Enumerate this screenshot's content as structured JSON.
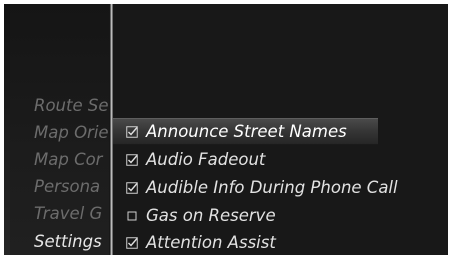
{
  "sidebar": {
    "items": [
      {
        "label": "Route Se",
        "active": false
      },
      {
        "label": "Map Orie",
        "active": false
      },
      {
        "label": "Map Cor",
        "active": false
      },
      {
        "label": "Persona",
        "active": false
      },
      {
        "label": "Travel G",
        "active": false
      },
      {
        "label": "Settings",
        "active": true
      }
    ]
  },
  "settings": {
    "options": [
      {
        "label": "Announce Street Names",
        "checked": true,
        "selected": true
      },
      {
        "label": "Audio Fadeout",
        "checked": true,
        "selected": false
      },
      {
        "label": "Audible Info During Phone Call",
        "checked": true,
        "selected": false
      },
      {
        "label": "Gas on Reserve",
        "checked": false,
        "selected": false
      },
      {
        "label": "Attention Assist",
        "checked": true,
        "selected": false
      }
    ]
  },
  "colors": {
    "background": "#171717",
    "text_active": "#e6e6e6",
    "text_inactive": "#6c6c6c"
  }
}
